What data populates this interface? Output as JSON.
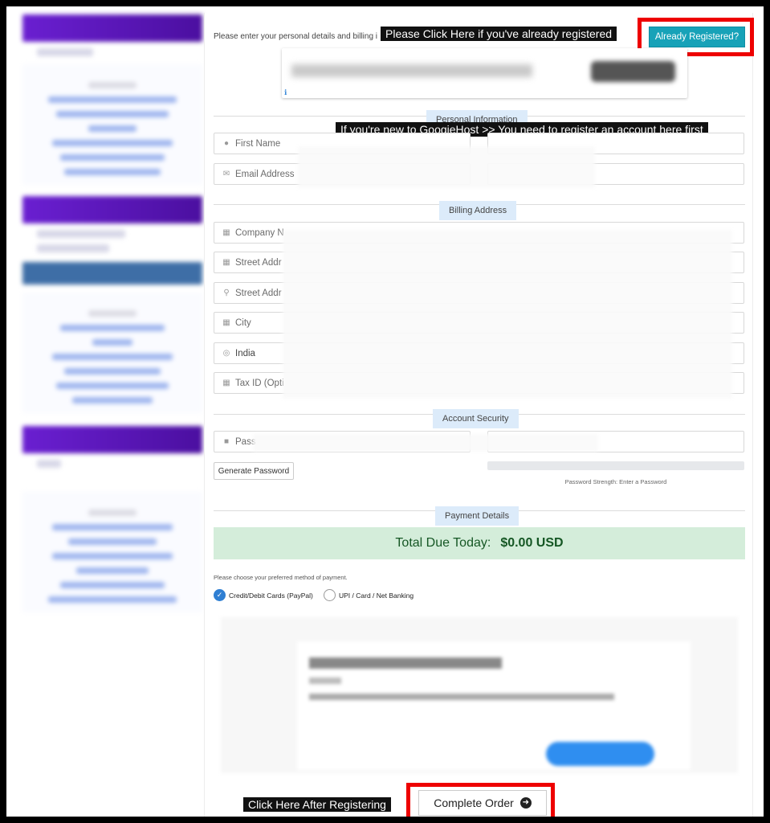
{
  "header": {
    "intro_text": "Please enter your personal details and billing i",
    "already_registered_banner": "Please Click Here if you've already registered",
    "already_registered_button": "Already Registered?"
  },
  "personal": {
    "section_title": "Personal Information",
    "new_user_banner": "If you're new to GoogieHost >> You need to register an account here first",
    "first_name_placeholder": "First Name",
    "email_placeholder": "Email Address"
  },
  "billing": {
    "section_title": "Billing Address",
    "company_placeholder": "Company N",
    "street1_placeholder": "Street Addr",
    "street2_placeholder": "Street Addr",
    "city_placeholder": "City",
    "country_value": "India",
    "taxid_placeholder": "Tax ID (Opti"
  },
  "security": {
    "section_title": "Account Security",
    "password_placeholder": "Pass",
    "generate_button": "Generate Password",
    "strength_text": "Password Strength: Enter a Password"
  },
  "payment": {
    "section_title": "Payment Details",
    "total_label": "Total Due Today:",
    "total_value": "$0.00 USD",
    "choose_text": "Please choose your preferred method of payment.",
    "methods": [
      {
        "label": "Credit/Debit Cards (PayPal)",
        "selected": true
      },
      {
        "label": "UPI / Card / Net Banking",
        "selected": false
      }
    ]
  },
  "footer": {
    "after_register_banner": "Click Here After Registering",
    "complete_button": "Complete Order"
  },
  "colors": {
    "accent_teal": "#17a2b8",
    "highlight_red": "#e00000",
    "success_bg": "#d4edda",
    "success_text": "#155724",
    "section_tab_bg": "#dcebfa"
  },
  "icons": [
    "user-icon",
    "envelope-icon",
    "building-icon",
    "location-icon",
    "globe-icon",
    "lock-icon",
    "arrow-right-circle-icon",
    "check-icon"
  ]
}
